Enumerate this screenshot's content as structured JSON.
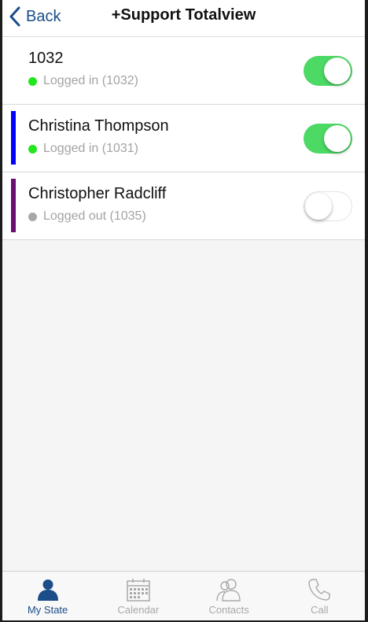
{
  "navbar": {
    "back_label": "Back",
    "title": "+Support Totalview"
  },
  "colors": {
    "accent": "#1b4d89",
    "toggle_on": "#4cd964",
    "status_logged_in": "#22e61e",
    "status_logged_out": "#a8a8a8"
  },
  "users": [
    {
      "name": "1032",
      "status": "Logged in (1032)",
      "status_color": "#22e61e",
      "bar_color": "",
      "enabled": true
    },
    {
      "name": "Christina Thompson",
      "status": "Logged in (1031)",
      "status_color": "#22e61e",
      "bar_color": "#0000ff",
      "enabled": true
    },
    {
      "name": "Christopher Radcliff",
      "status": "Logged out (1035)",
      "status_color": "#a8a8a8",
      "bar_color": "#6b0f72",
      "enabled": false
    }
  ],
  "tabbar": {
    "tabs": [
      {
        "label": "My State",
        "icon": "person-icon",
        "active": true
      },
      {
        "label": "Calendar",
        "icon": "calendar-icon",
        "active": false
      },
      {
        "label": "Contacts",
        "icon": "contacts-icon",
        "active": false
      },
      {
        "label": "Call",
        "icon": "phone-icon",
        "active": false
      }
    ]
  }
}
